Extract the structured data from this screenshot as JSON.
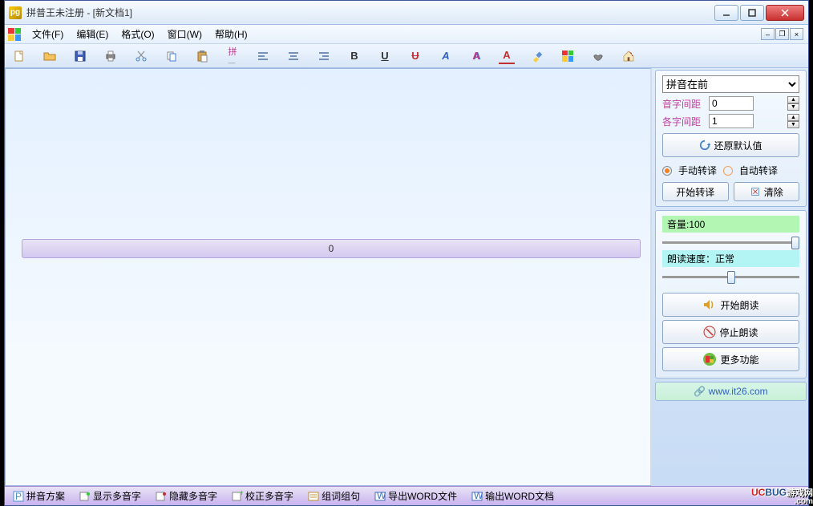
{
  "title": "拼普王未注册  - [新文档1]",
  "menus": {
    "file": "文件(F)",
    "edit": "编辑(E)",
    "format": "格式(O)",
    "window": "窗口(W)",
    "help": "帮助(H)"
  },
  "editor": {
    "row_value": "0"
  },
  "side": {
    "pinyin_mode_selected": "拼音在前",
    "spacing_yin": {
      "label": "音字间距",
      "value": "0"
    },
    "spacing_ge": {
      "label": "各字间距",
      "value": "1"
    },
    "restore_default": "还原默认值",
    "manual_translate": "手动转译",
    "auto_translate": "自动转译",
    "start_translate": "开始转译",
    "clear": "清除",
    "volume_label": "音量:100",
    "volume_value": 100,
    "speed_label": "朗读速度：正常",
    "speed_value": 50,
    "start_read": "开始朗读",
    "stop_read": "停止朗读",
    "more_functions": "更多功能",
    "website": "www.it26.com"
  },
  "bottom": {
    "pinyin_scheme": "拼音方案",
    "show_polyphone": "显示多音字",
    "hide_polyphone": "隐藏多音字",
    "correct_polyphone": "校正多音字",
    "word_sentence": "组词组句",
    "export_word_file": "导出WORD文件",
    "export_word_doc": "输出WORD文档"
  },
  "watermark": {
    "brand": "UCBUG",
    "cn": "游戏网",
    "com": ".com"
  }
}
